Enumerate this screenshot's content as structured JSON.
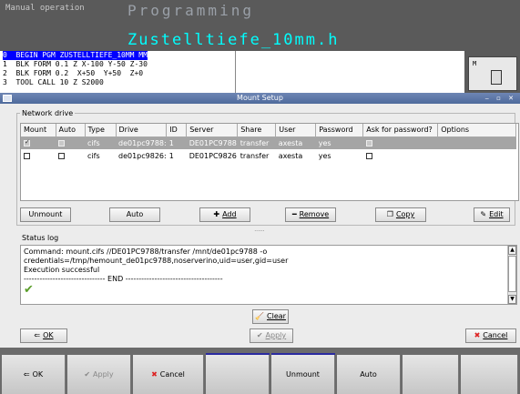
{
  "header": {
    "mode_machine": "Manual operation",
    "mode_program": "Programming",
    "filename": "Zustelltiefe_10mm.h"
  },
  "program": {
    "lines": [
      "0  BEGIN PGM ZUSTELLTIEFE_10MM MM",
      "1  BLK FORM 0.1 Z X-100 Y-50 Z-30",
      "2  BLK FORM 0.2  X+50  Y+50  Z+0",
      "3  TOOL CALL 10 Z S2000"
    ]
  },
  "side_panel": {
    "label": "M"
  },
  "dialog": {
    "title": "Mount Setup",
    "network_drive_label": "Network drive",
    "columns": [
      "Mount",
      "Auto",
      "Type",
      "Drive",
      "ID",
      "Server",
      "Share",
      "User",
      "Password",
      "Ask for password?",
      "Options"
    ],
    "rows": [
      {
        "mount": true,
        "auto": false,
        "type": "cifs",
        "drive": "de01pc9788:",
        "id": "1",
        "server": "DE01PC9788",
        "share": "transfer",
        "user": "axesta",
        "password": "yes",
        "ask": false,
        "options": ""
      },
      {
        "mount": false,
        "auto": false,
        "type": "cifs",
        "drive": "de01pc9826:",
        "id": "1",
        "server": "DE01PC9826",
        "share": "transfer",
        "user": "axesta",
        "password": "yes",
        "ask": false,
        "options": ""
      }
    ],
    "buttons": {
      "unmount": "Unmount",
      "auto": "Auto",
      "add": "Add",
      "remove": "Remove",
      "copy": "Copy",
      "edit": "Edit",
      "clear": "Clear",
      "ok": "OK",
      "apply": "Apply",
      "cancel": "Cancel"
    },
    "status_log_label": "Status log",
    "log_lines": [
      "Command: mount.cifs //DE01PC9788/transfer /mnt/de01pc9788 -o credentials=/tmp/hemount_de01pc9788,noserverino,uid=user,gid=user",
      "Execution successful",
      "------------------------------- END -------------------------------------"
    ]
  },
  "softkeys": {
    "ok": "OK",
    "apply": "Apply",
    "cancel": "Cancel",
    "unmount": "Unmount",
    "auto": "Auto"
  },
  "colors": {
    "program_highlight": "#0000ff",
    "filename": "#00ffff",
    "title_bar": "#5a74a8",
    "selected_row": "#a5a5a5"
  }
}
